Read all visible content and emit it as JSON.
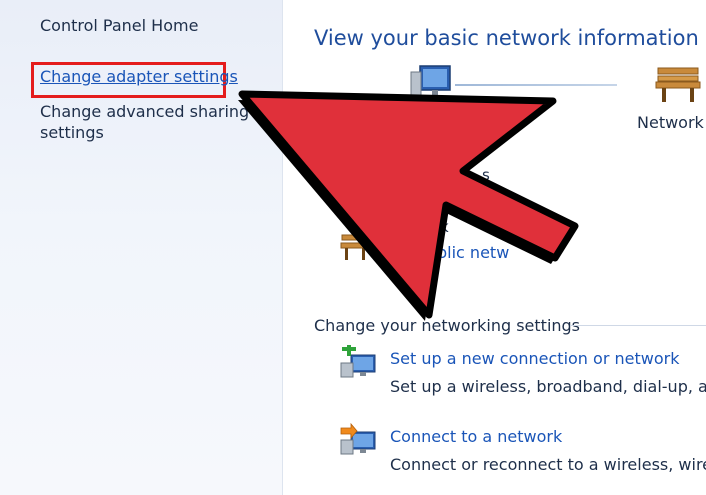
{
  "sidebar": {
    "home_label": "Control Panel Home",
    "adapter_link": "Change adapter settings",
    "advanced_sharing": "Change advanced sharing settings"
  },
  "main": {
    "title": "View your basic network information an",
    "network_label": "Network",
    "partial_text_1": "s",
    "partial_text_2": "k",
    "public_link": "blic netw",
    "section_heading": "Change your networking settings",
    "tasks": [
      {
        "link": "Set up a new connection or network",
        "desc": "Set up a wireless, broadband, dial-up, ad h",
        "icon": "new-connection-icon"
      },
      {
        "link": "Connect to a network",
        "desc": "Connect or reconnect to a wireless, wired,",
        "icon": "connect-network-icon"
      }
    ]
  },
  "annotation": {
    "arrow_color": "#e0303a",
    "highlight_color": "#e41c1c"
  }
}
